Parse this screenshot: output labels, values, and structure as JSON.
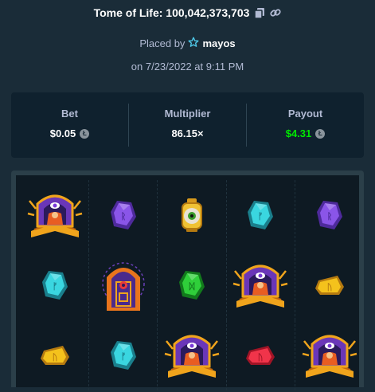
{
  "header": {
    "title": "Tome of Life: 100,042,373,703",
    "placed_by_label": "Placed by",
    "username": "mayos",
    "date": "on 7/23/2022 at 9:11 PM"
  },
  "stats": {
    "bet": {
      "label": "Bet",
      "value": "$0.05"
    },
    "multiplier": {
      "label": "Multiplier",
      "value": "86.15×"
    },
    "payout": {
      "label": "Payout",
      "value": "$4.31"
    }
  },
  "colors": {
    "background": "#1a2c38",
    "panel": "#0f212e",
    "muted_text": "#b1bad3",
    "payout_green": "#00e701"
  },
  "reels": [
    [
      "tome-wild",
      "purple-gem",
      "eye-lantern",
      "cyan-gem",
      "purple-gem"
    ],
    [
      "cyan-gem",
      "arch-door",
      "green-gem",
      "tome-wild",
      "yellow-gem"
    ],
    [
      "yellow-gem",
      "cyan-gem",
      "tome-wild",
      "red-gem",
      "tome-wild"
    ]
  ]
}
